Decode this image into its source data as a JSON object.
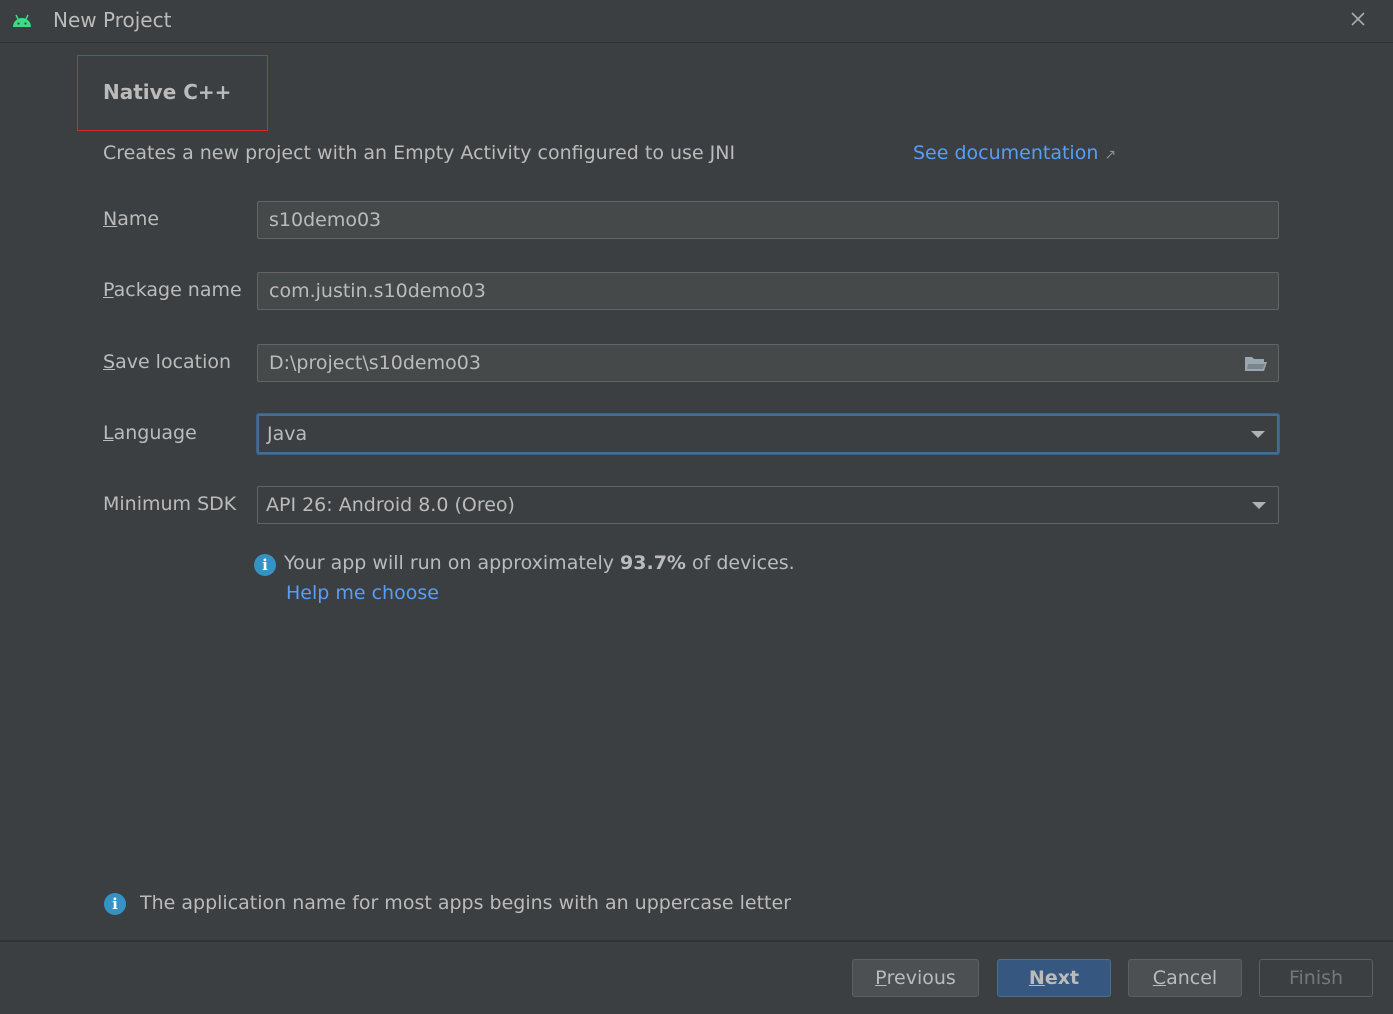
{
  "window": {
    "title": "New Project",
    "icon": "android-icon",
    "close_icon": "close-icon"
  },
  "template": {
    "name": "Native C++",
    "description": "Creates a new project with an Empty Activity configured to use JNI",
    "doc_link": "See documentation",
    "doc_link_arrow": "↗"
  },
  "form": {
    "name": {
      "label_mnemonic": "N",
      "label_rest": "ame",
      "value": "s10demo03"
    },
    "package_name": {
      "label_mnemonic": "P",
      "label_rest": "ackage name",
      "value": "com.justin.s10demo03"
    },
    "save_location": {
      "label_mnemonic": "S",
      "label_rest": "ave location",
      "value": "D:\\project\\s10demo03"
    },
    "language": {
      "label_mnemonic": "L",
      "label_rest": "anguage",
      "value": "Java"
    },
    "minimum_sdk": {
      "label": "Minimum SDK",
      "value": "API 26: Android 8.0 (Oreo)"
    }
  },
  "sdk_info": {
    "prefix": "Your app will run on approximately ",
    "percent": "93.7%",
    "suffix": " of devices.",
    "help_link": "Help me choose"
  },
  "bottom_hint": "The application name for most apps begins with an uppercase letter",
  "buttons": {
    "previous": {
      "mnemonic": "P",
      "rest": "revious"
    },
    "next": {
      "mnemonic": "N",
      "rest": "ext"
    },
    "cancel": {
      "mnemonic": "C",
      "rest": "ancel"
    },
    "finish": {
      "label": "Finish"
    }
  },
  "colors": {
    "background": "#3c3f41",
    "link": "#589df6",
    "info": "#3592c4",
    "highlight_box": "#d62a2a",
    "default_button": "#365880"
  }
}
